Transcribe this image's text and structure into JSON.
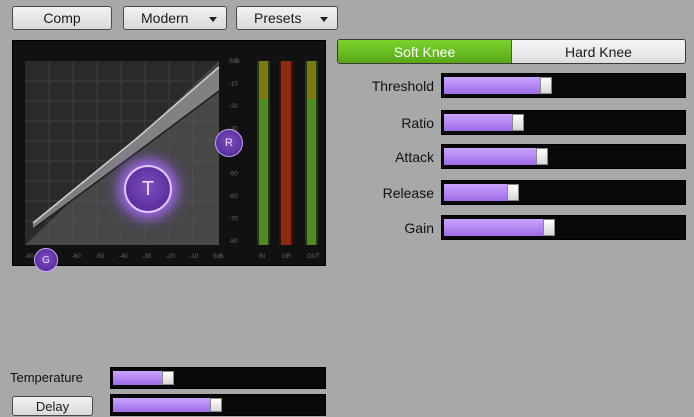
{
  "toolbar": {
    "comp_label": "Comp",
    "mode_label": "Modern",
    "presets_label": "Presets"
  },
  "graph": {
    "x_ticks": [
      "-80",
      "-70",
      "-60",
      "-50",
      "-40",
      "-30",
      "-20",
      "-10",
      "0dB"
    ],
    "y_ticks": [
      "0dB",
      "-10",
      "-20",
      "-30",
      "-40",
      "-50",
      "-60",
      "-70",
      "-80"
    ],
    "meter_labels": [
      "IN",
      "GR",
      "OUT"
    ],
    "nodes": {
      "gate": "G",
      "threshold": "T",
      "ratio": "R"
    }
  },
  "knee": {
    "soft_label": "Soft Knee",
    "hard_label": "Hard Knee",
    "selected": "soft"
  },
  "params": [
    {
      "label": "Threshold",
      "level": 0.42
    },
    {
      "label": "Ratio",
      "level": 0.3
    },
    {
      "label": "Attack",
      "level": 0.4
    },
    {
      "label": "Release",
      "level": 0.28
    },
    {
      "label": "Gain",
      "level": 0.43
    }
  ],
  "bottom": {
    "temperature_label": "Temperature",
    "temperature_level": 0.25,
    "delay_label": "Delay",
    "delay_level": 0.48
  },
  "colors": {
    "accent_green": "#6fc424",
    "slider_purple": "#b48af5",
    "node_purple": "#5b2f9e"
  }
}
